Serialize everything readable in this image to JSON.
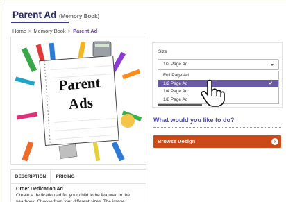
{
  "product": {
    "title": "Parent Ad",
    "subtitle": "(Memory Book)"
  },
  "breadcrumb": {
    "items": [
      "Home",
      "Memory Book",
      "Parent Ad"
    ],
    "separator": ">"
  },
  "image": {
    "text_line1": "Parent",
    "text_line2": "Ads"
  },
  "size": {
    "label": "Size",
    "selected": "1/2 Page Ad",
    "options": [
      "Full Page Ad",
      "1/2 Page Ad",
      "1/4 Page Ad",
      "1/8 Page Ad"
    ],
    "check": "✔"
  },
  "what": {
    "heading": "What would you like to do?"
  },
  "browse": {
    "label": "Browse Design",
    "arrow": "›"
  },
  "tabs": {
    "description": "DESCRIPTION",
    "pricing": "PRICING"
  },
  "description": {
    "heading": "Order Dedication Ad",
    "text": "Create a dedication ad for your child to be featured in the yearbook. Choose from four different sizes. The image"
  },
  "colors": {
    "accent": "#6a5aa5",
    "button": "#cc4a17",
    "title": "#27276b",
    "link": "#4a4ab0"
  }
}
